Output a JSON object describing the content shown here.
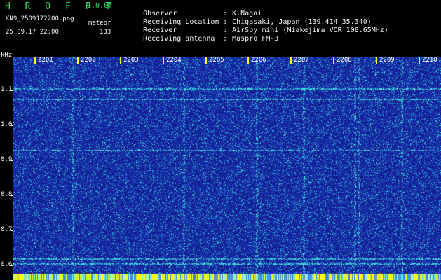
{
  "header": {
    "app_title": "H R O F F T",
    "version": "1.0.0f",
    "filename": "KN9_2509172200.png",
    "mode_label": "meteor",
    "datetime": "25.09.17 22:00",
    "count": "133"
  },
  "meta": [
    {
      "label": "Observer",
      "value": "K.Nagai"
    },
    {
      "label": "Receiving Location",
      "value": "Chigasaki, Japan (139.414 35.340)"
    },
    {
      "label": "Receiver",
      "value": "AirSpy mini (Miakejima VOR 108.65MHz)"
    },
    {
      "label": "Receiving antenna",
      "value": "Maspro FM-3"
    }
  ],
  "y_axis": {
    "unit": "kHz",
    "ticks": [
      "1.1",
      "1.0",
      "0.9",
      "0.8",
      "0.7",
      "0.6"
    ]
  },
  "x_axis": {
    "labels": [
      "2201",
      "2202",
      "2203",
      "2204",
      "2205",
      "2206",
      "2207",
      "2208",
      "2209",
      "2210"
    ]
  },
  "colors": {
    "background": "#000000",
    "spectrogram_base": "#1b2bb0",
    "noise_bright": "#2ee6e6",
    "title_green": "#2ee06a",
    "marker_yellow": "#ffff00"
  },
  "chart_data": {
    "type": "heatmap",
    "x_unit_label": "",
    "ylabel": "kHz",
    "x_tick_labels": [
      "2201",
      "2202",
      "2203",
      "2204",
      "2205",
      "2206",
      "2207",
      "2208",
      "2209",
      "2210"
    ],
    "y_tick_labels": [
      "1.1",
      "1.0",
      "0.9",
      "0.8",
      "0.7",
      "0.6"
    ],
    "ylim": [
      0.58,
      1.2
    ],
    "horizontal_lines_khz": [
      1.105,
      1.075,
      0.93,
      0.62,
      0.605
    ],
    "vertical_streaks_minute": [
      2201.9,
      2204.5,
      2206.2,
      2207.3,
      2208.5,
      2208.6,
      2209.6
    ]
  }
}
